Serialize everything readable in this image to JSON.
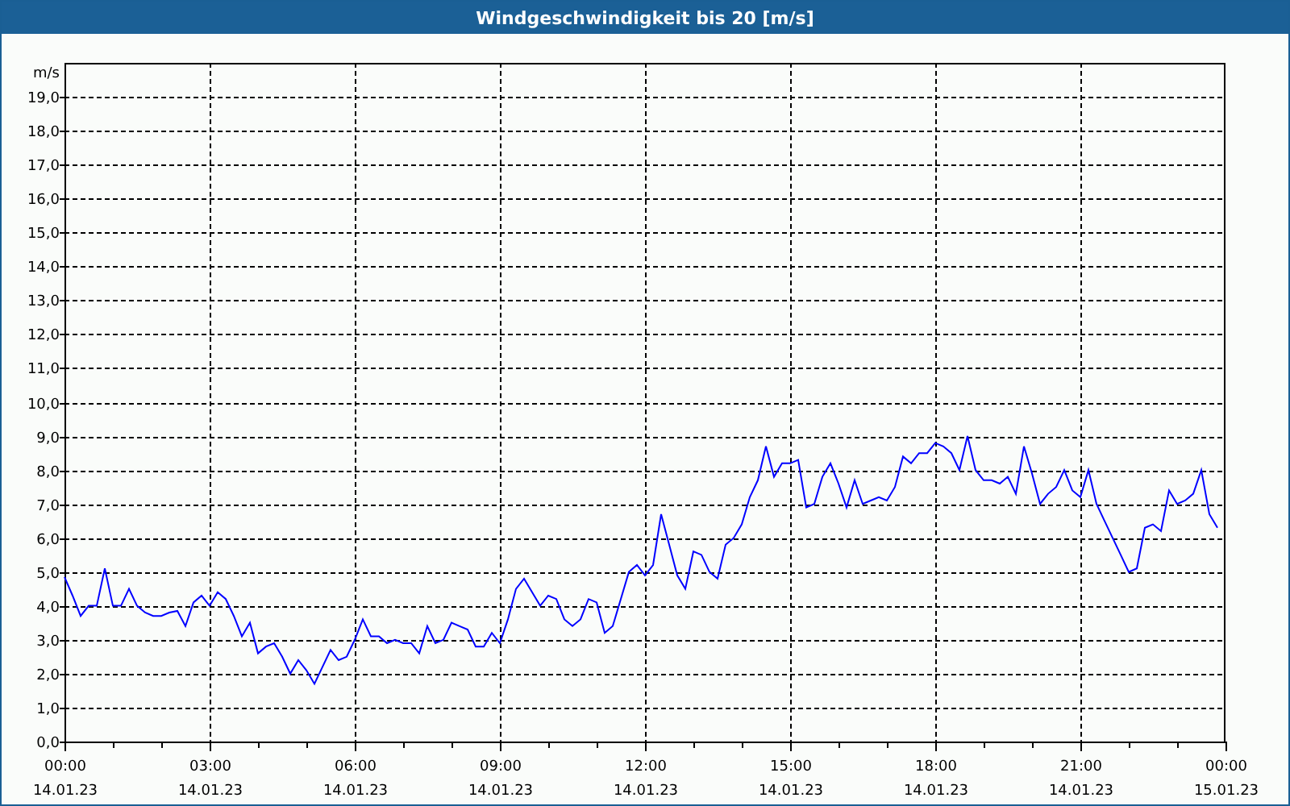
{
  "chart_data": {
    "type": "line",
    "title": "Windgeschwindigkeit bis 20 [m/s]",
    "ylabel": "m/s",
    "grid": true,
    "ylim": [
      0,
      20
    ],
    "yticks": [
      {
        "value": 0,
        "label": "0,0"
      },
      {
        "value": 1,
        "label": "1,0"
      },
      {
        "value": 2,
        "label": "2,0"
      },
      {
        "value": 3,
        "label": "3,0"
      },
      {
        "value": 4,
        "label": "4,0"
      },
      {
        "value": 5,
        "label": "5,0"
      },
      {
        "value": 6,
        "label": "6,0"
      },
      {
        "value": 7,
        "label": "7,0"
      },
      {
        "value": 8,
        "label": "8,0"
      },
      {
        "value": 9,
        "label": "9,0"
      },
      {
        "value": 10,
        "label": "10,0"
      },
      {
        "value": 11,
        "label": "11,0"
      },
      {
        "value": 12,
        "label": "12,0"
      },
      {
        "value": 13,
        "label": "13,0"
      },
      {
        "value": 14,
        "label": "14,0"
      },
      {
        "value": 15,
        "label": "15,0"
      },
      {
        "value": 16,
        "label": "16,0"
      },
      {
        "value": 17,
        "label": "17,0"
      },
      {
        "value": 18,
        "label": "18,0"
      },
      {
        "value": 19,
        "label": "19,0"
      }
    ],
    "categories": [
      "00:00\n14.01.23",
      null,
      null,
      null,
      null,
      null,
      null,
      null,
      null,
      null,
      null,
      null,
      null,
      null,
      null,
      null,
      null,
      null,
      "03:00\n14.01.23",
      null,
      null,
      null,
      null,
      null,
      null,
      null,
      null,
      null,
      null,
      null,
      null,
      null,
      null,
      null,
      null,
      null,
      "06:00\n14.01.23",
      null,
      null,
      null,
      null,
      null,
      null,
      null,
      null,
      null,
      null,
      null,
      null,
      null,
      null,
      null,
      null,
      null,
      "09:00\n14.01.23",
      null,
      null,
      null,
      null,
      null,
      null,
      null,
      null,
      null,
      null,
      null,
      null,
      null,
      null,
      null,
      null,
      null,
      "12:00\n14.01.23",
      null,
      null,
      null,
      null,
      null,
      null,
      null,
      null,
      null,
      null,
      null,
      null,
      null,
      null,
      null,
      null,
      null,
      "15:00\n14.01.23",
      null,
      null,
      null,
      null,
      null,
      null,
      null,
      null,
      null,
      null,
      null,
      null,
      null,
      null,
      null,
      null,
      null,
      "18:00\n14.01.23",
      null,
      null,
      null,
      null,
      null,
      null,
      null,
      null,
      null,
      null,
      null,
      null,
      null,
      null,
      null,
      null,
      null,
      "21:00\n14.01.23",
      null,
      null,
      null,
      null,
      null,
      null,
      null,
      null,
      null,
      null,
      null,
      null,
      null,
      null,
      null,
      null,
      null,
      "00:00\n15.01.23"
    ],
    "series": [
      {
        "color": "#0000ff",
        "values": [
          4.85,
          4.3,
          3.7,
          4.0,
          4.0,
          5.1,
          4.0,
          4.0,
          4.5,
          4.0,
          3.8,
          3.7,
          3.7,
          3.8,
          3.85,
          3.4,
          4.1,
          4.3,
          4.0,
          4.4,
          4.2,
          3.7,
          3.1,
          3.5,
          2.6,
          2.8,
          2.9,
          2.5,
          2.0,
          2.4,
          2.1,
          1.7,
          2.2,
          2.7,
          2.4,
          2.5,
          3.0,
          3.6,
          3.1,
          3.1,
          2.9,
          3.0,
          2.9,
          2.9,
          2.6,
          3.4,
          2.9,
          3.0,
          3.5,
          3.4,
          3.3,
          2.8,
          2.8,
          3.2,
          2.9,
          3.6,
          4.5,
          4.8,
          4.4,
          4.0,
          4.3,
          4.2,
          3.6,
          3.4,
          3.6,
          4.2,
          4.1,
          3.2,
          3.4,
          4.2,
          5.0,
          5.2,
          4.9,
          5.2,
          6.7,
          5.8,
          4.9,
          4.5,
          5.6,
          5.5,
          5.0,
          4.8,
          5.8,
          6.0,
          6.4,
          7.2,
          7.7,
          8.7,
          7.8,
          8.2,
          8.2,
          8.3,
          6.9,
          7.0,
          7.8,
          8.2,
          7.6,
          6.9,
          7.7,
          7.0,
          7.1,
          7.2,
          7.1,
          7.5,
          8.4,
          8.2,
          8.5,
          8.5,
          8.8,
          8.7,
          8.5,
          8.0,
          9.0,
          8.0,
          7.7,
          7.7,
          7.6,
          7.8,
          7.3,
          8.7,
          7.9,
          7.0,
          7.3,
          7.5,
          8.0,
          7.4,
          7.2,
          8.0,
          7.0,
          6.5,
          6.0,
          5.5,
          5.0,
          5.1,
          6.3,
          6.4,
          6.2,
          7.4,
          7.0,
          7.1,
          7.3,
          8.0,
          6.7,
          6.3,
          null
        ]
      }
    ]
  }
}
